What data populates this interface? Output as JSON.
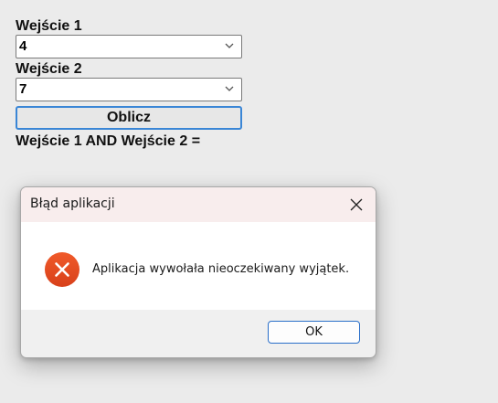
{
  "form": {
    "input1_label": "Wejście 1",
    "input1_value": "4",
    "input2_label": "Wejście 2",
    "input2_value": "7",
    "calc_button": "Oblicz",
    "result_text": "Wejście 1 AND Wejście 2 ="
  },
  "dialog": {
    "title": "Błąd aplikacji",
    "message": "Aplikacja wywołała nieoczekiwany wyjątek.",
    "ok_button": "OK",
    "icon": "error-icon"
  },
  "colors": {
    "accent": "#3a86d6",
    "error_icon": "#e0451b",
    "titlebar_bg": "#f8eded"
  }
}
